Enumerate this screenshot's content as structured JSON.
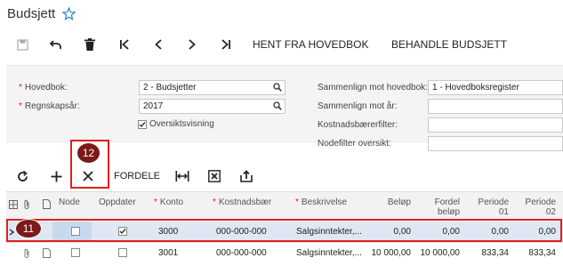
{
  "page": {
    "title": "Budsjett"
  },
  "toolbar": {
    "fetch_label": "HENT FRA HOVEDBOK",
    "process_label": "BEHANDLE BUDSJETT"
  },
  "form": {
    "hovedbok_label": "Hovedbok:",
    "hovedbok_value": "2 - Budsjetter",
    "regnskapsar_label": "Regnskapsår:",
    "regnskapsar_value": "2017",
    "oversikt_label": "Oversiktsvisning",
    "compare_ledger_label": "Sammenlign mot hovedbok:",
    "compare_ledger_value": "1 - Hovedboksregister",
    "compare_year_label": "Sammenlign mot år:",
    "cost_filter_label": "Kostnadsbærerfilter:",
    "node_filter_label": "Nodefilter oversikt:"
  },
  "grid_toolbar": {
    "distribute_label": "FORDELE"
  },
  "grid": {
    "headers": {
      "node": "Node",
      "oppdater": "Oppdater",
      "konto": "Konto",
      "kostnadsbaer": "Kostnadsbær",
      "beskrivelse": "Beskrivelse",
      "belop": "Beløp",
      "fordel_1": "Fordel",
      "fordel_2": "beløp",
      "periode01_1": "Periode",
      "periode01_2": "01",
      "periode02_1": "Periode",
      "periode02_2": "02"
    },
    "rows": [
      {
        "konto": "3000",
        "kostnadsbaer": "000-000-000",
        "beskrivelse": "Salgsinntekter,...",
        "belop": "0,00",
        "fordel": "0,00",
        "p01": "0,00",
        "p02": "0,00",
        "oppdater": true
      },
      {
        "konto": "3001",
        "kostnadsbaer": "000-000-000",
        "beskrivelse": "Salgsinntekter,...",
        "belop": "10 000,00",
        "fordel": "10 000,00",
        "p01": "833,34",
        "p02": "833,34",
        "oppdater": false
      }
    ]
  },
  "callouts": {
    "badge_12": "12",
    "badge_11": "11"
  },
  "colors": {
    "accent": "#1a7bd1",
    "callout_red": "#e02020",
    "badge": "#7a1a1a",
    "selected_row": "#dfe7f2"
  }
}
